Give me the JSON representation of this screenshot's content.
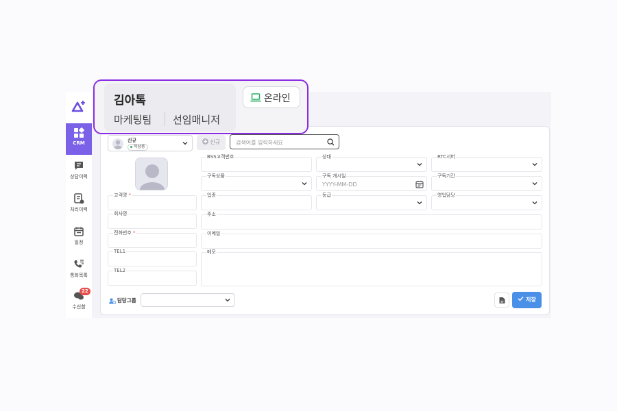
{
  "sidebar": {
    "items": [
      {
        "label": "CRM"
      },
      {
        "label": "상담이력"
      },
      {
        "label": "처리이력"
      },
      {
        "label": "일정"
      },
      {
        "label": "통화목록"
      },
      {
        "label": "수신함",
        "badge": "22"
      }
    ]
  },
  "agent": {
    "name": "김아톡",
    "team": "마케팅팀",
    "role": "선임매니저",
    "status": "온라인"
  },
  "toolbar": {
    "customer_name": "신규",
    "customer_status": "작성중",
    "new_button": "신규",
    "search_placeholder": "검색어를 입력하세요"
  },
  "form": {
    "customer_name_label": "고객명",
    "company_label": "회사명",
    "phone_label": "전화번호",
    "tel1_label": "TEL1",
    "tel2_label": "TEL2",
    "bss_label": "BSS고객번호",
    "status_label": "상태",
    "rtc_label": "RTC서버",
    "product_label": "구독상품",
    "start_date_label": "구독 개시일",
    "start_date_placeholder": "YYYY-MM-DD",
    "period_label": "구독기간",
    "industry_label": "업종",
    "grade_label": "등급",
    "sales_label": "영업담당",
    "address_label": "주소",
    "email_label": "이메일",
    "memo_label": "메모",
    "required_mark": "*"
  },
  "footer": {
    "group_label": "담당그룹",
    "save_label": "저장"
  },
  "colors": {
    "accent": "#7b61e8",
    "popup_border": "#8a2be2",
    "online": "#27ae60",
    "save": "#4a90e8",
    "badge": "#e74c4c"
  }
}
